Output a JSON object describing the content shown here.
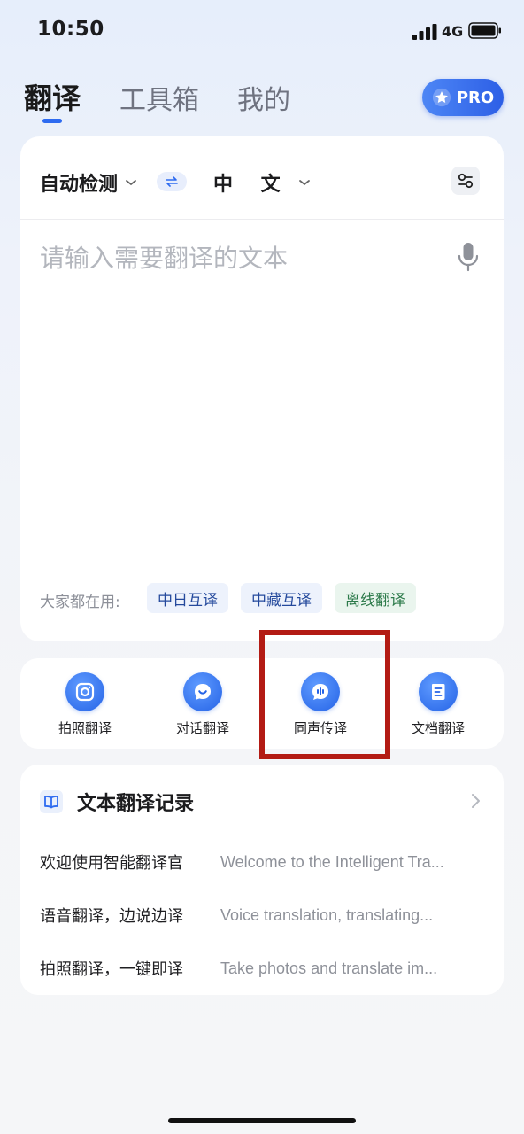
{
  "status_bar": {
    "time": "10:50",
    "network": "4G"
  },
  "tabs": [
    {
      "label": "翻译",
      "active": true
    },
    {
      "label": "工具箱",
      "active": false
    },
    {
      "label": "我的",
      "active": false
    }
  ],
  "pro": {
    "label": "PRO"
  },
  "language": {
    "source": "自动检测",
    "target": "中 文"
  },
  "input": {
    "placeholder": "请输入需要翻译的文本"
  },
  "suggestions": {
    "label": "大家都在用:",
    "chips": [
      "中日互译",
      "中藏互译",
      "离线翻译"
    ]
  },
  "features": [
    {
      "label": "拍照翻译",
      "icon": "camera-icon"
    },
    {
      "label": "对话翻译",
      "icon": "chat-icon"
    },
    {
      "label": "同声传译",
      "icon": "voice-wave-icon"
    },
    {
      "label": "文档翻译",
      "icon": "document-icon"
    }
  ],
  "history": {
    "title": "文本翻译记录",
    "items": [
      {
        "source": "欢迎使用智能翻译官",
        "translation": "Welcome to the Intelligent Tra..."
      },
      {
        "source": "语音翻译，边说边译",
        "translation": "Voice translation, translating..."
      },
      {
        "source": "拍照翻译，一键即译",
        "translation": "Take photos and translate im..."
      }
    ]
  },
  "colors": {
    "accent": "#2e6bf0",
    "highlight": "#b31b14"
  }
}
